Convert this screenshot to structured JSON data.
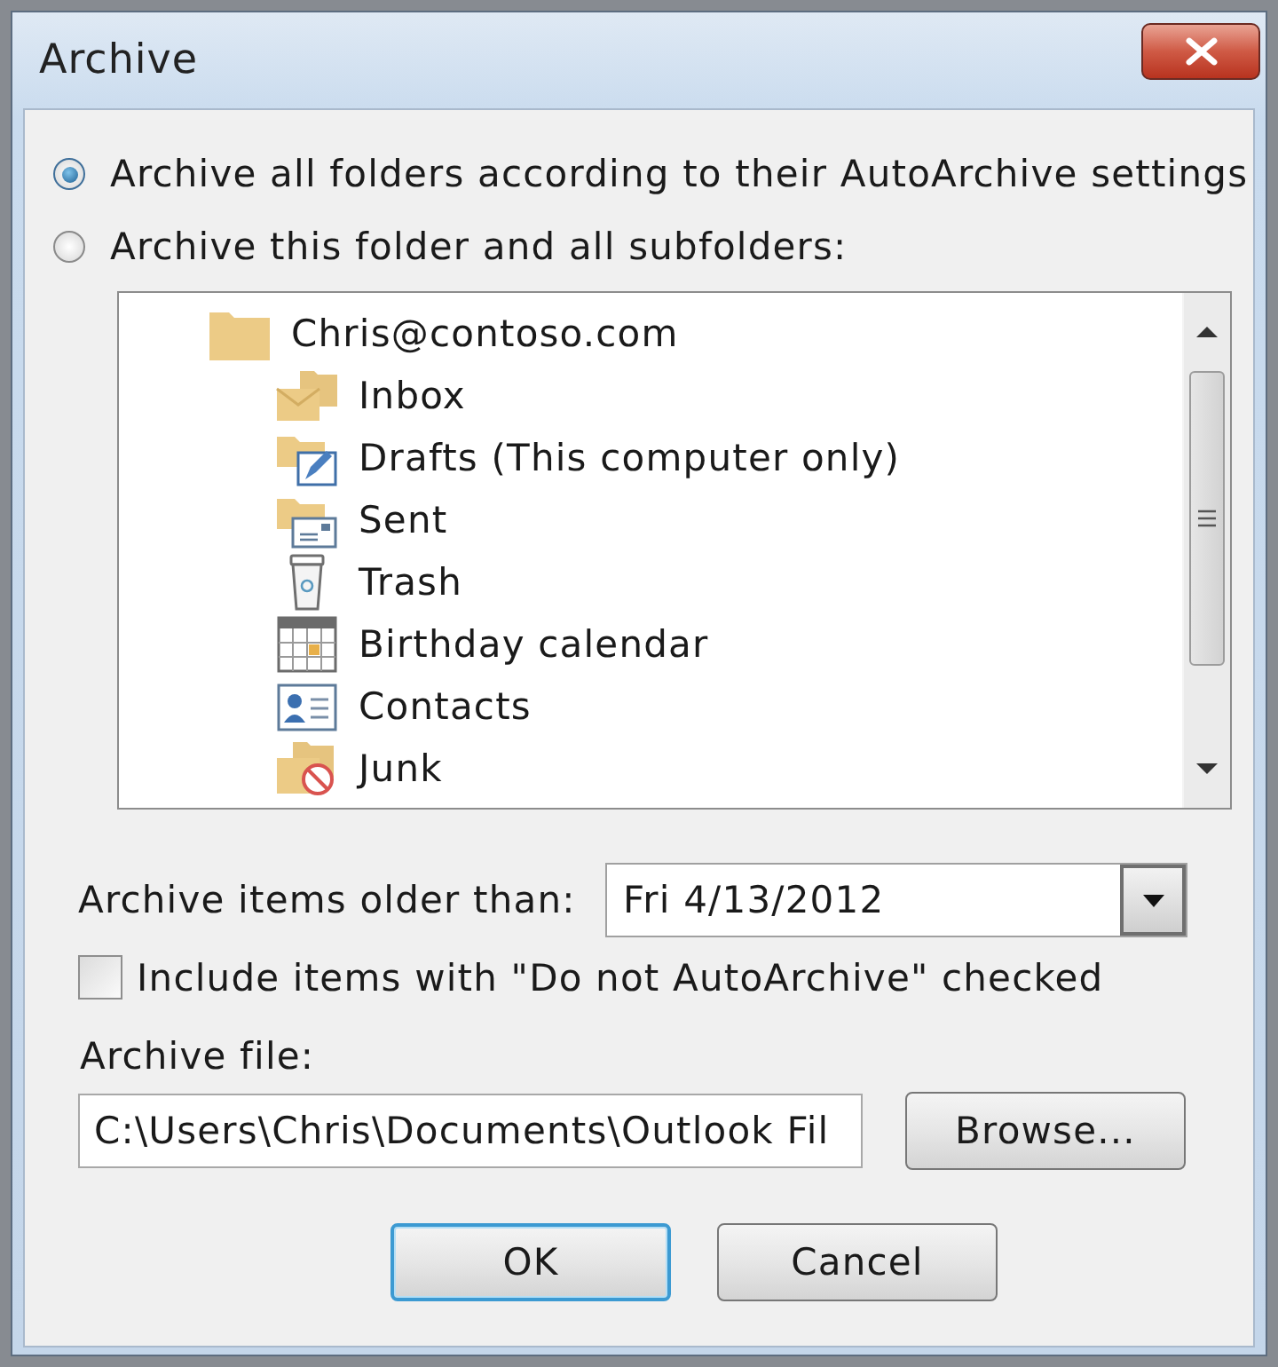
{
  "window": {
    "title": "Archive"
  },
  "options": [
    {
      "label": "Archive all folders according to their AutoArchive settings",
      "selected": true
    },
    {
      "label": "Archive this folder and all subfolders:",
      "selected": false
    }
  ],
  "folder_tree": {
    "items": [
      {
        "label": "Chris@contoso.com",
        "kind": "folder",
        "children": [
          {
            "label": "Inbox",
            "kind": "inbox"
          },
          {
            "label": "Drafts (This computer only)",
            "kind": "drafts"
          },
          {
            "label": "Sent",
            "kind": "sent"
          },
          {
            "label": "Trash",
            "kind": "trash"
          },
          {
            "label": "Birthday calendar",
            "kind": "calendar"
          },
          {
            "label": "Contacts",
            "kind": "contacts"
          },
          {
            "label": "Junk",
            "kind": "junk"
          }
        ]
      }
    ]
  },
  "older_than": {
    "label": "Archive items older than:",
    "value": "Fri 4/13/2012"
  },
  "include_option": {
    "label": "Include items with \"Do not AutoArchive\" checked",
    "checked": false
  },
  "archive_file": {
    "label": "Archive file:",
    "value": "C:\\Users\\Chris\\Documents\\Outlook Fil",
    "browse_button": "Browse..."
  },
  "buttons": [
    {
      "label": "OK",
      "default": true
    },
    {
      "label": "Cancel",
      "default": false
    }
  ]
}
